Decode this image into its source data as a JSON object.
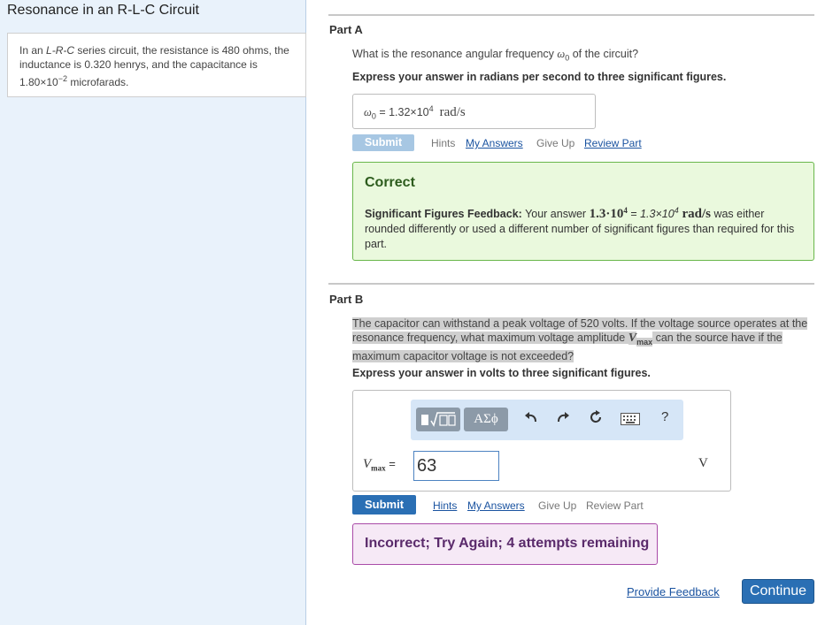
{
  "sidebar": {
    "title": "Resonance in an R-L-C Circuit",
    "problem": {
      "p1": "In an ",
      "p1_italic": "L-R-C",
      "p2": " series circuit, the resistance is 480 ohms, the inductance is 0.320 henrys, and the capacitance is 1.80×10",
      "exp": "−2",
      "p3": " microfarads."
    }
  },
  "partA": {
    "title": "Part A",
    "question_pre": "What is the resonance angular frequency ",
    "question_symbol": "ω",
    "question_sub": "0",
    "question_post": " of the circuit?",
    "instruction": "Express your answer in radians per second to three significant figures.",
    "answer_label_symbol": "ω",
    "answer_label_sub": "0",
    "answer_eq": " = ",
    "answer_mantissa": "1.32×10",
    "answer_exp": "4",
    "answer_unit": "rad/s",
    "submit_label": "Submit",
    "links": {
      "hints": "Hints",
      "my_answers": "My Answers",
      "give_up": "Give Up",
      "review_part": "Review Part"
    },
    "feedback": {
      "title": "Correct",
      "label": "Significant Figures Feedback:",
      "t1": " Your answer ",
      "v1": "1.3·10",
      "v1exp": "4",
      "t2": " = ",
      "v2": "1.3×10",
      "v2exp": "4",
      "unit": " rad/s",
      "t3": " was either rounded differently or used a different number of significant figures than required for this part."
    }
  },
  "partB": {
    "title": "Part B",
    "q1": "The capacitor can withstand a peak voltage of 520 volts. If the voltage source operates at the resonance frequency, what maximum voltage amplitude ",
    "q_sym": "V",
    "q_sub": "max",
    "q2": " can the source have if the maximum capacitor voltage is not exceeded?",
    "instruction": "Express your answer in volts to three significant figures.",
    "toolbar": {
      "template_icon": "template-sqrt-icon",
      "symbols_label": "ΑΣϕ",
      "undo_icon": "undo-icon",
      "redo_icon": "redo-icon",
      "reset_icon": "reset-icon",
      "keyboard_icon": "keyboard-icon",
      "help_label": "?"
    },
    "input_label_sym": "V",
    "input_label_sub": "max",
    "input_eq": " =",
    "input_value": "63",
    "unit": "V",
    "submit_label": "Submit",
    "links": {
      "hints": "Hints",
      "my_answers": "My Answers",
      "give_up": "Give Up",
      "review_part": "Review Part"
    },
    "feedback": "Incorrect; Try Again; 4 attempts remaining"
  },
  "footer": {
    "provide_feedback": "Provide Feedback",
    "continue_label": "Continue"
  },
  "colors": {
    "sidebar_bg": "#e9f2fb",
    "primary_button": "#2a6fb4",
    "correct_bg": "#eaf9dd",
    "correct_border": "#69b74b",
    "incorrect_bg": "#f6e9f6",
    "incorrect_border": "#a94ba8"
  }
}
